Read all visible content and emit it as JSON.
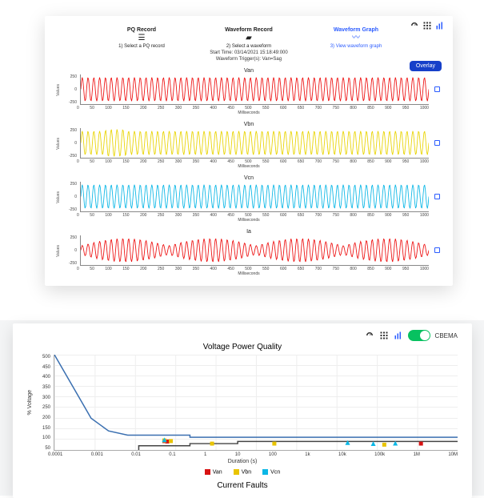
{
  "card1": {
    "top_icons": [
      "gauge-icon",
      "grid-icon",
      "bar-chart-icon"
    ],
    "steps": [
      {
        "title": "PQ Record",
        "icon": "list-icon",
        "sub": "1) Select a PQ record",
        "active": false
      },
      {
        "title": "Waveform Record",
        "icon": "file-icon",
        "sub": "2) Select a waveform",
        "active": false
      },
      {
        "title": "Waveform Graph",
        "icon": "wave-icon",
        "sub": "3) View waveform graph",
        "active": true
      }
    ],
    "meta_start": "Start Time: 03/14/2021 15:18:49:000",
    "meta_trigger": "Waveform Trigger(s): Van=Sag",
    "overlay_btn": "Overlay",
    "x_axis_label": "Milliseconds",
    "y_axis_label": "Values",
    "x_ticks": [
      "0",
      "50",
      "100",
      "150",
      "200",
      "250",
      "300",
      "350",
      "400",
      "450",
      "500",
      "550",
      "600",
      "650",
      "700",
      "750",
      "800",
      "850",
      "900",
      "950",
      "1000"
    ],
    "y_ticks": [
      "250",
      "0",
      "-250"
    ],
    "waveforms": [
      {
        "name": "Van",
        "color": "#e11"
      },
      {
        "name": "Vbn",
        "color": "#e9d400"
      },
      {
        "name": "Vcn",
        "color": "#0bb7e6"
      },
      {
        "name": "Ia",
        "color": "#e11"
      }
    ]
  },
  "card2": {
    "top_icons": [
      "gauge-icon",
      "grid-icon",
      "bar-chart-icon"
    ],
    "toggle_label": "CBEMA",
    "title": "Voltage Power Quality",
    "y_label": "% Voltage",
    "y_ticks": [
      "500",
      "450",
      "400",
      "350",
      "300",
      "250",
      "200",
      "150",
      "100",
      "50"
    ],
    "x_label": "Duration (s)",
    "x_ticks": [
      "0.0001",
      "0.001",
      "0.01",
      "0.1",
      "1",
      "10",
      "100",
      "1k",
      "10k",
      "100k",
      "1M",
      "10M"
    ],
    "legend": [
      {
        "label": "Van",
        "color": "#d81313"
      },
      {
        "label": "Vbn",
        "color": "#e9c400"
      },
      {
        "label": "Vcn",
        "color": "#0bb7e6"
      }
    ],
    "section2_title": "Current Faults"
  },
  "chart_data": [
    {
      "type": "line",
      "title": "Van",
      "xlabel": "Milliseconds",
      "ylabel": "Values",
      "xlim": [
        0,
        1000
      ],
      "ylim": [
        -250,
        250
      ],
      "note": "~60 Hz sinusoid, amplitude ≈200 V, red"
    },
    {
      "type": "line",
      "title": "Vbn",
      "xlabel": "Milliseconds",
      "ylabel": "Values",
      "xlim": [
        0,
        1000
      ],
      "ylim": [
        -250,
        250
      ],
      "note": "~60 Hz sinusoid, amplitude ≈200 V with disturbance near 80–120 ms, yellow"
    },
    {
      "type": "line",
      "title": "Vcn",
      "xlabel": "Milliseconds",
      "ylabel": "Values",
      "xlim": [
        0,
        1000
      ],
      "ylim": [
        -250,
        250
      ],
      "note": "~60 Hz sinusoid, amplitude ≈200 V, cyan"
    },
    {
      "type": "line",
      "title": "Ia",
      "xlabel": "Milliseconds",
      "ylabel": "Values",
      "xlim": [
        0,
        1000
      ],
      "ylim": [
        -250,
        250
      ],
      "note": "irregular sinusoid amplitude ≈50–150, red"
    },
    {
      "type": "scatter",
      "title": "Voltage Power Quality",
      "xlabel": "Duration (s)",
      "ylabel": "% Voltage",
      "x_scale": "log",
      "xlim": [
        0.0001,
        10000000
      ],
      "ylim": [
        50,
        500
      ],
      "series": [
        {
          "name": "CBEMA upper",
          "type": "line",
          "color": "#3a6fb0",
          "points": [
            [
              0.0001,
              500
            ],
            [
              0.001,
              200
            ],
            [
              0.003,
              140
            ],
            [
              0.01,
              120
            ],
            [
              0.5,
              120
            ],
            [
              0.5,
              110
            ],
            [
              10000000,
              110
            ]
          ]
        },
        {
          "name": "CBEMA lower",
          "type": "line",
          "color": "#444",
          "points": [
            [
              0.02,
              50
            ],
            [
              0.02,
              70
            ],
            [
              0.5,
              70
            ],
            [
              0.5,
              80
            ],
            [
              10,
              80
            ],
            [
              10,
              90
            ],
            [
              10000000,
              90
            ]
          ]
        },
        {
          "name": "Van",
          "type": "scatter",
          "shape": "square",
          "color": "#d81313",
          "points": [
            [
              0.1,
              92
            ],
            [
              0.12,
              90
            ],
            [
              1000000,
              80
            ]
          ]
        },
        {
          "name": "Vbn",
          "type": "scatter",
          "shape": "square",
          "color": "#e9c400",
          "points": [
            [
              0.1,
              95
            ],
            [
              0.15,
              92
            ],
            [
              2,
              80
            ],
            [
              100,
              80
            ],
            [
              100000,
              75
            ]
          ]
        },
        {
          "name": "Vcn",
          "type": "scatter",
          "shape": "triangle",
          "color": "#0bb7e6",
          "points": [
            [
              0.1,
              98
            ],
            [
              10000,
              85
            ],
            [
              50000,
              80
            ],
            [
              200000,
              82
            ]
          ]
        }
      ]
    }
  ]
}
